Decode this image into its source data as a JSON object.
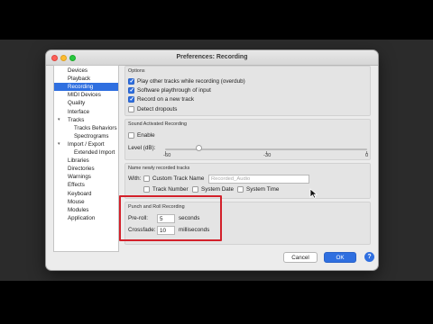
{
  "window": {
    "title": "Preferences: Recording"
  },
  "sidebar": {
    "items": [
      {
        "label": "Devices",
        "selected": false,
        "indent": 0
      },
      {
        "label": "Playback",
        "selected": false,
        "indent": 0
      },
      {
        "label": "Recording",
        "selected": true,
        "indent": 0
      },
      {
        "label": "MIDI Devices",
        "selected": false,
        "indent": 0
      },
      {
        "label": "Quality",
        "selected": false,
        "indent": 0
      },
      {
        "label": "Interface",
        "selected": false,
        "indent": 0
      },
      {
        "label": "Tracks",
        "selected": false,
        "indent": 0,
        "expanded": true
      },
      {
        "label": "Tracks Behaviors",
        "selected": false,
        "indent": 1
      },
      {
        "label": "Spectrograms",
        "selected": false,
        "indent": 1
      },
      {
        "label": "Import / Export",
        "selected": false,
        "indent": 0,
        "expanded": true
      },
      {
        "label": "Extended Import",
        "selected": false,
        "indent": 1
      },
      {
        "label": "Libraries",
        "selected": false,
        "indent": 0
      },
      {
        "label": "Directories",
        "selected": false,
        "indent": 0
      },
      {
        "label": "Warnings",
        "selected": false,
        "indent": 0
      },
      {
        "label": "Effects",
        "selected": false,
        "indent": 0
      },
      {
        "label": "Keyboard",
        "selected": false,
        "indent": 0
      },
      {
        "label": "Mouse",
        "selected": false,
        "indent": 0
      },
      {
        "label": "Modules",
        "selected": false,
        "indent": 0
      },
      {
        "label": "Application",
        "selected": false,
        "indent": 0
      }
    ]
  },
  "options": {
    "header": "Options",
    "items": [
      {
        "label": "Play other tracks while recording (overdub)",
        "checked": true
      },
      {
        "label": "Software playthrough of input",
        "checked": true
      },
      {
        "label": "Record on a new track",
        "checked": true
      },
      {
        "label": "Detect dropouts",
        "checked": false
      }
    ]
  },
  "sound_activated": {
    "header": "Sound Activated Recording",
    "enable_label": "Enable",
    "enable_checked": false,
    "level_label": "Level (dB):",
    "level_value": -50,
    "scale_labels": [
      "-60",
      "-30",
      "0"
    ]
  },
  "naming": {
    "header": "Name newly recorded tracks",
    "with_label": "With:",
    "custom_track_name_label": "Custom Track Name",
    "custom_track_name_checked": false,
    "custom_name_placeholder": "Recorded_Audio",
    "track_number_label": "Track Number",
    "track_number_checked": false,
    "system_date_label": "System Date",
    "system_date_checked": false,
    "system_time_label": "System Time",
    "system_time_checked": false
  },
  "punch_roll": {
    "header": "Punch and Roll Recording",
    "preroll_label": "Pre-roll:",
    "preroll_value": "5",
    "preroll_unit": "seconds",
    "crossfade_label": "Crossfade:",
    "crossfade_value": "10",
    "crossfade_unit": "milliseconds"
  },
  "buttons": {
    "cancel": "Cancel",
    "ok": "OK",
    "help": "?"
  },
  "colors": {
    "accent": "#2f6fe0",
    "highlight_box": "#d3202a"
  }
}
